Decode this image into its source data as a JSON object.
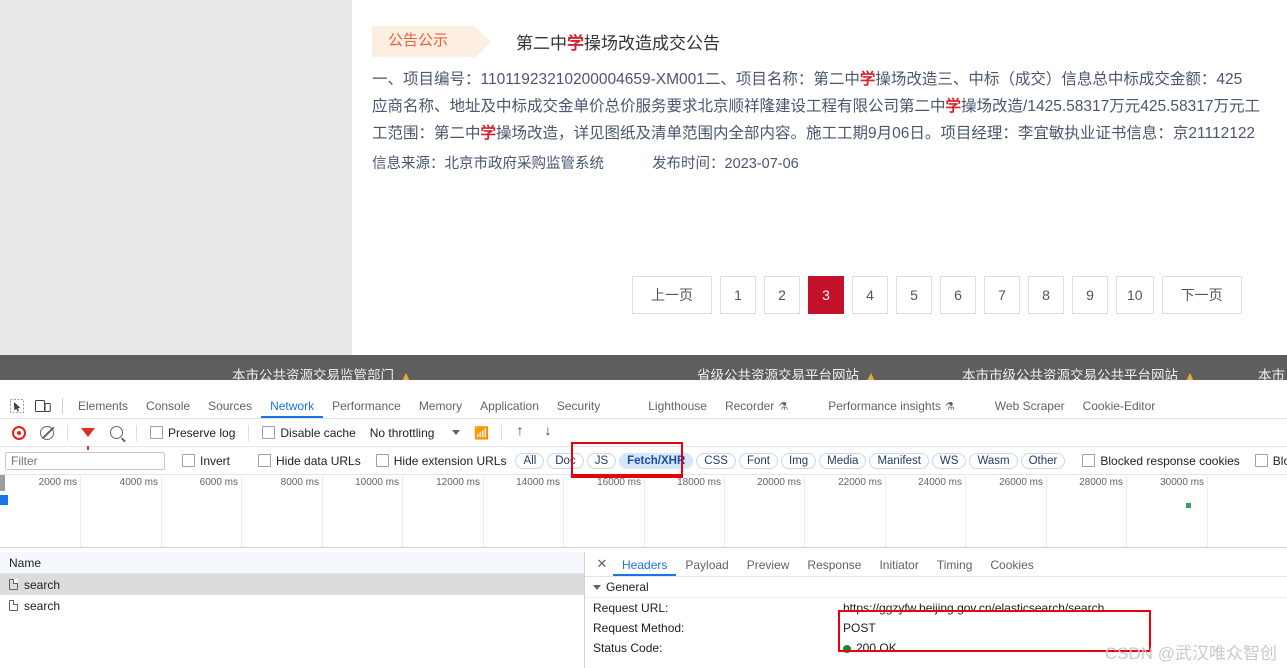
{
  "page": {
    "tag_label": "公告公示",
    "title_pre": "第二中",
    "title_hl": "学",
    "title_post": "操场改造成交公告",
    "body_lines": [
      {
        "pre": "一、项目编号：11011923210200004659-XM001二、项目名称：第二中",
        "hl": "学",
        "post": "操场改造三、中标（成交）信息总中标成交金额：425"
      },
      {
        "pre": "应商名称、地址及中标成交金单价总价服务要求北京顺祥隆建设工程有限公司第二中",
        "hl": "学",
        "post": "操场改造/1425.58317万元425.58317万元工"
      },
      {
        "pre": "工范围：第二中",
        "hl": "学",
        "post": "操场改造，详见图纸及清单范围内全部内容。施工工期9月06日。项目经理：李宜敏执业证书信息：京21112122"
      }
    ],
    "source_label": "信息来源：北京市政府采购监管系统",
    "publish_label": "发布时间：2023-07-06",
    "pager": {
      "prev": "上一页",
      "next": "下一页",
      "pages": [
        "1",
        "2",
        "3",
        "4",
        "5",
        "6",
        "7",
        "8",
        "9",
        "10"
      ],
      "active": "3"
    },
    "strip_items": [
      {
        "text": "本市公共资源交易监管部门",
        "warn": "▲"
      },
      {
        "text": "省级公共资源交易平台网站",
        "warn": "▲"
      },
      {
        "text": "本市市级公共资源交易公共平台网站",
        "warn": "▲"
      },
      {
        "text": "本市",
        "warn": ""
      }
    ]
  },
  "devtools": {
    "tabs": [
      {
        "label": "Elements",
        "selected": false,
        "beaker": false
      },
      {
        "label": "Console",
        "selected": false,
        "beaker": false
      },
      {
        "label": "Sources",
        "selected": false,
        "beaker": false
      },
      {
        "label": "Network",
        "selected": true,
        "beaker": false
      },
      {
        "label": "Performance",
        "selected": false,
        "beaker": false
      },
      {
        "label": "Memory",
        "selected": false,
        "beaker": false
      },
      {
        "label": "Application",
        "selected": false,
        "beaker": false
      },
      {
        "label": "Security",
        "selected": false,
        "beaker": false
      },
      {
        "label": "Lighthouse",
        "selected": false,
        "beaker": false
      },
      {
        "label": "Recorder",
        "selected": false,
        "beaker": true
      },
      {
        "label": "Performance insights",
        "selected": false,
        "beaker": true
      },
      {
        "label": "Web Scraper",
        "selected": false,
        "beaker": false
      },
      {
        "label": "Cookie-Editor",
        "selected": false,
        "beaker": false
      }
    ],
    "beaker_glyph": "⚗",
    "toolbar": {
      "preserve_log": "Preserve log",
      "disable_cache": "Disable cache",
      "throttling": "No throttling"
    },
    "filterbar": {
      "filter_placeholder": "Filter",
      "invert": "Invert",
      "hide_data_urls": "Hide data URLs",
      "hide_extension_urls": "Hide extension URLs",
      "types": [
        "All",
        "Doc",
        "JS",
        "Fetch/XHR",
        "CSS",
        "Font",
        "Img",
        "Media",
        "Manifest",
        "WS",
        "Wasm",
        "Other"
      ],
      "selected_type": "Fetch/XHR",
      "blocked_response_cookies": "Blocked response cookies",
      "blocked_requests": "Blocked request"
    },
    "overview": {
      "ticks": [
        "2000 ms",
        "4000 ms",
        "6000 ms",
        "8000 ms",
        "10000 ms",
        "12000 ms",
        "14000 ms",
        "16000 ms",
        "18000 ms",
        "20000 ms",
        "22000 ms",
        "24000 ms",
        "26000 ms",
        "28000 ms",
        "30000 ms"
      ]
    },
    "requests": {
      "column_header": "Name",
      "rows": [
        {
          "name": "search",
          "selected": true
        },
        {
          "name": "search",
          "selected": false
        }
      ]
    },
    "detail": {
      "close_glyph": "✕",
      "tabs": [
        "Headers",
        "Payload",
        "Preview",
        "Response",
        "Initiator",
        "Timing",
        "Cookies"
      ],
      "selected_tab": "Headers",
      "section_general": "General",
      "fields": [
        {
          "key": "Request URL:",
          "value": "https://ggzyfw.beijing.gov.cn/elasticsearch/search",
          "status": false
        },
        {
          "key": "Request Method:",
          "value": "POST",
          "status": false
        },
        {
          "key": "Status Code:",
          "value": "200 OK",
          "status": true
        }
      ]
    },
    "watermark": "CSDN @武汉唯众智创",
    "accent_blue": "#1a73e8",
    "highlight_red": "#e8000d"
  }
}
